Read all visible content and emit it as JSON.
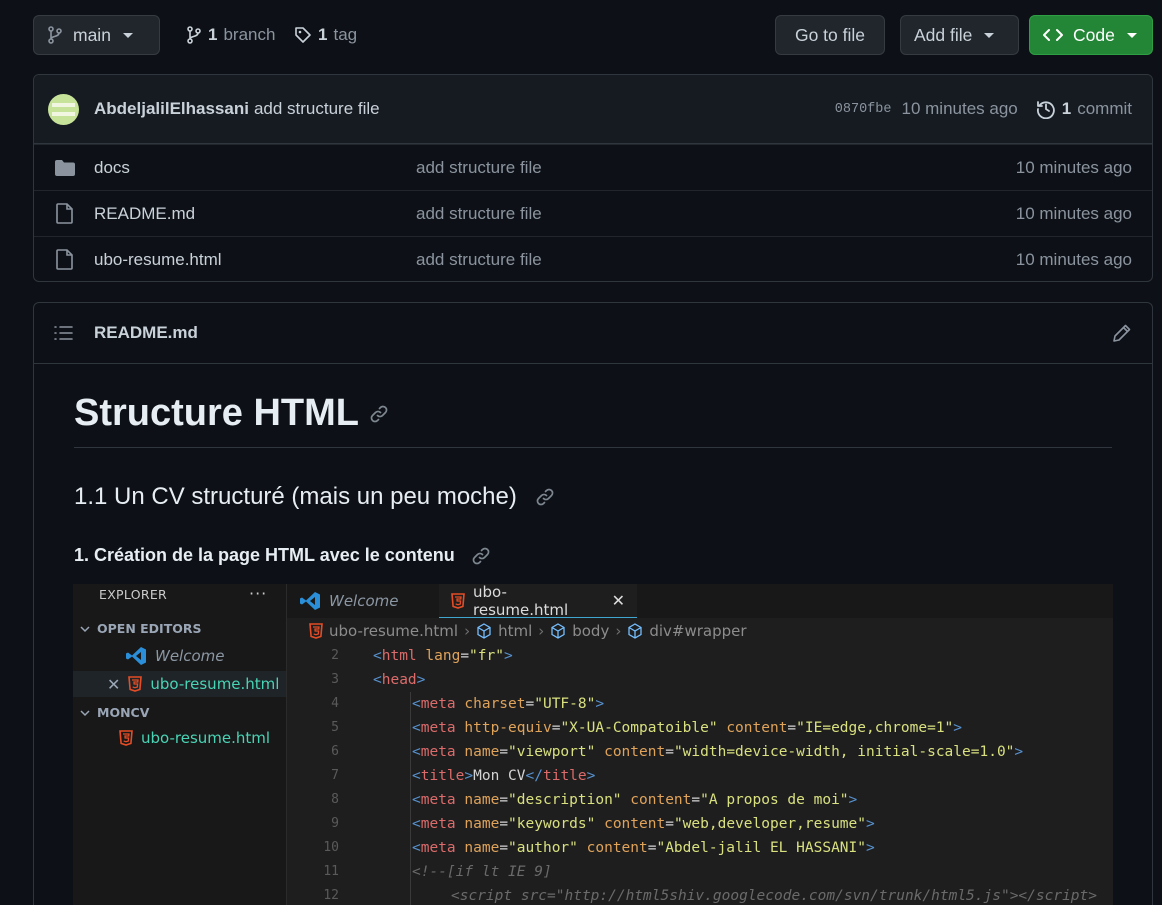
{
  "toolbar": {
    "branch_button": "main",
    "branches_count": "1",
    "branches_label": "branch",
    "tags_count": "1",
    "tags_label": "tag",
    "go_to_file": "Go to file",
    "add_file": "Add file",
    "code": "Code"
  },
  "commit": {
    "author": "AbdeljalilElhassani",
    "message": "add structure file",
    "sha": "0870fbe",
    "time": "10 minutes ago",
    "count": "1",
    "count_label": "commit"
  },
  "files": [
    {
      "name": "docs",
      "icon": "folder-icon",
      "commit": "add structure file",
      "age": "10 minutes ago"
    },
    {
      "name": "README.md",
      "icon": "file-icon",
      "commit": "add structure file",
      "age": "10 minutes ago"
    },
    {
      "name": "ubo-resume.html",
      "icon": "file-icon",
      "commit": "add structure file",
      "age": "10 minutes ago"
    }
  ],
  "readme": {
    "filename": "README.md",
    "h1": "Structure HTML",
    "h2": "1.1 Un CV structuré (mais un peu moche)",
    "h3": "1. Création de la page HTML avec le contenu"
  },
  "vscode": {
    "explorer": "EXPLORER",
    "dots": "···",
    "open_editors": "OPEN EDITORS",
    "welcome": "Welcome",
    "open_file": "ubo-resume.html",
    "folder": "MONCV",
    "folder_file": "ubo-resume.html",
    "tab_welcome": "Welcome",
    "tab_active": "ubo-resume.html",
    "breadcrumb": [
      "ubo-resume.html",
      "html",
      "body",
      "div#wrapper"
    ],
    "lines": [
      {
        "n": "2",
        "indent": 0,
        "html": "<span class='tg'>&lt;</span><span class='tn'>html</span> <span class='an'>lang</span><span class='tx'>=</span><span class='av'>\"fr\"</span><span class='tg'>&gt;</span>"
      },
      {
        "n": "3",
        "indent": 0,
        "html": "<span class='tg'>&lt;</span><span class='tn'>head</span><span class='tg'>&gt;</span>"
      },
      {
        "n": "4",
        "indent": 1,
        "html": "<span class='tg'>&lt;</span><span class='tn'>meta</span> <span class='an'>charset</span><span class='tx'>=</span><span class='av'>\"UTF-8\"</span><span class='tg'>&gt;</span>"
      },
      {
        "n": "5",
        "indent": 1,
        "html": "<span class='tg'>&lt;</span><span class='tn'>meta</span> <span class='an'>http-equiv</span><span class='tx'>=</span><span class='av'>\"X-UA-Compatoible\"</span> <span class='an'>content</span><span class='tx'>=</span><span class='av'>\"IE=edge,chrome=1\"</span><span class='tg'>&gt;</span>"
      },
      {
        "n": "6",
        "indent": 1,
        "html": "<span class='tg'>&lt;</span><span class='tn'>meta</span> <span class='an'>name</span><span class='tx'>=</span><span class='av'>\"viewport\"</span> <span class='an'>content</span><span class='tx'>=</span><span class='av'>\"width=device-width, initial-scale=1.0\"</span><span class='tg'>&gt;</span>"
      },
      {
        "n": "7",
        "indent": 1,
        "html": "<span class='tg'>&lt;</span><span class='tn'>title</span><span class='tg'>&gt;</span><span class='tx'>Mon CV</span><span class='tg'>&lt;/</span><span class='tn'>title</span><span class='tg'>&gt;</span>"
      },
      {
        "n": "8",
        "indent": 1,
        "html": "<span class='tg'>&lt;</span><span class='tn'>meta</span> <span class='an'>name</span><span class='tx'>=</span><span class='av'>\"description\"</span> <span class='an'>content</span><span class='tx'>=</span><span class='av'>\"A propos de moi\"</span><span class='tg'>&gt;</span>"
      },
      {
        "n": "9",
        "indent": 1,
        "html": "<span class='tg'>&lt;</span><span class='tn'>meta</span> <span class='an'>name</span><span class='tx'>=</span><span class='av'>\"keywords\"</span> <span class='an'>content</span><span class='tx'>=</span><span class='av'>\"web,developer,resume\"</span><span class='tg'>&gt;</span>"
      },
      {
        "n": "10",
        "indent": 1,
        "html": "<span class='tg'>&lt;</span><span class='tn'>meta</span> <span class='an'>name</span><span class='tx'>=</span><span class='av'>\"author\"</span> <span class='an'>content</span><span class='tx'>=</span><span class='av'>\"Abdel-jalil EL HASSANI\"</span><span class='tg'>&gt;</span>"
      },
      {
        "n": "11",
        "indent": 1,
        "html": "<span class='cm'>&lt;!--[if lt IE 9]</span>"
      },
      {
        "n": "12",
        "indent": 2,
        "html": "<span class='cm'>&lt;script src=\"http://html5shiv.googlecode.com/svn/trunk/html5.js\"&gt;&lt;/script&gt;</span>"
      }
    ]
  },
  "colors": {
    "background": "#0d1117",
    "panel": "#161b22",
    "border": "#30363d",
    "green_button": "#238636",
    "html_icon": "#e44d26",
    "vscode_blue": "#3ea6cf"
  }
}
